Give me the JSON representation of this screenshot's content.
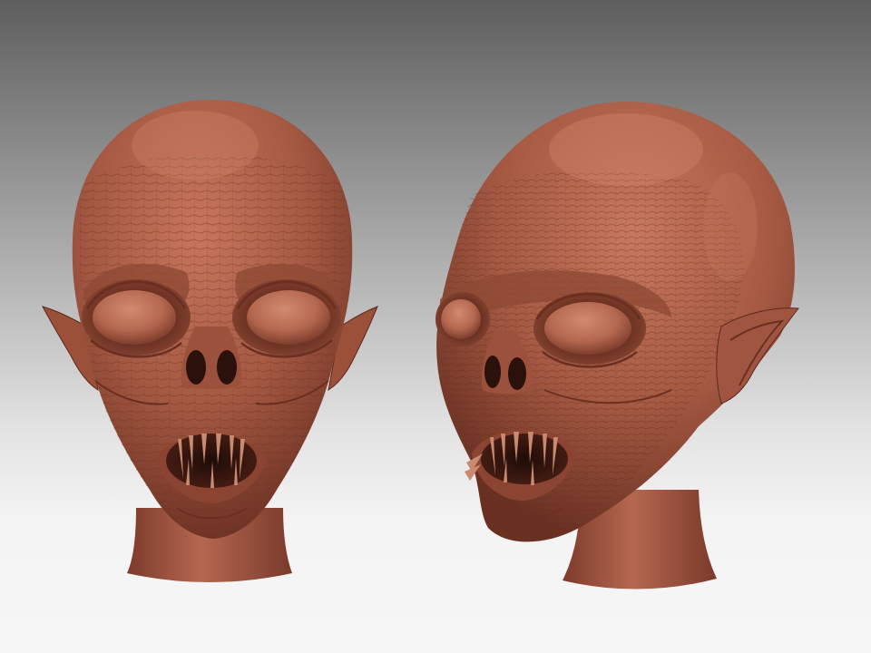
{
  "scene": {
    "description_visible_text": "",
    "colors": {
      "background_top": "#5e5e5e",
      "background_bottom": "#f6f6f6",
      "clay_light": "#c4725a",
      "clay_mid": "#a75a44",
      "clay_dark": "#6e3425",
      "clay_deep": "#3d1a12"
    }
  },
  "subjects": [
    {
      "view": "front"
    },
    {
      "view": "three-quarter"
    }
  ]
}
